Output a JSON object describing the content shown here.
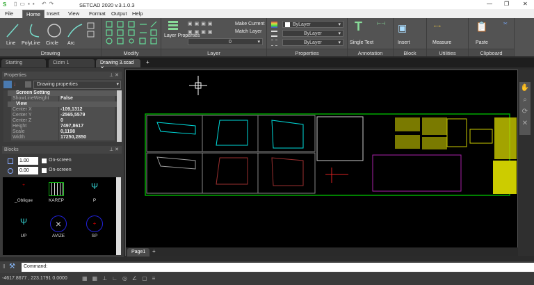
{
  "title": "SETCAD 2020 v.3.1.0.3",
  "menu": [
    "File",
    "Home",
    "Insert",
    "View",
    "Format",
    "Output",
    "Help"
  ],
  "ribbon": {
    "drawing": {
      "label": "Drawing",
      "tools": [
        "Line",
        "PolyLine",
        "Circle",
        "Arc"
      ]
    },
    "modify": {
      "label": "Modify"
    },
    "layer": {
      "label": "Layer",
      "properties": "Layer Properties",
      "make_current": "Make Current",
      "match_layer": "Match Layer",
      "current_layer": "0"
    },
    "properties": {
      "label": "Properties",
      "color": "ByLayer",
      "linetype": "ByLayer",
      "lineweight": "ByLayer"
    },
    "annotation": {
      "label": "Annotation",
      "single_text": "Single Text"
    },
    "block": {
      "label": "Block",
      "insert": "Insert"
    },
    "utilities": {
      "label": "Utilities",
      "measure": "Measure"
    },
    "clipboard": {
      "label": "Clipboard",
      "paste": "Paste"
    }
  },
  "doc_tabs": [
    "Starting",
    "Cizim 1",
    "Drawing 3.scad"
  ],
  "properties_panel": {
    "title": "Properties",
    "selector": "Drawing properties",
    "sections": [
      {
        "name": "Screen Setting",
        "rows": [
          [
            "ShowLineWeight",
            "False"
          ]
        ]
      },
      {
        "name": "View",
        "rows": [
          [
            "Center X",
            "-109,1312"
          ],
          [
            "Center Y",
            "-2565,5579"
          ],
          [
            "Center Z",
            "0"
          ],
          [
            "Height",
            "7497,8617"
          ],
          [
            "Scale",
            "0,1198"
          ],
          [
            "Width",
            "17250,2850"
          ]
        ]
      }
    ]
  },
  "blocks_panel": {
    "title": "Blocks",
    "scale": "1.00",
    "rotation": "0.00",
    "on_screen": "On-screen",
    "items": [
      "_Oblique",
      "KAREP",
      "P",
      "UP",
      "AVIZE",
      "SP"
    ]
  },
  "page_tab": "Page1",
  "command": {
    "label": "Command:"
  },
  "status": {
    "coords": "-4617.8677 , 223.1791  0.0000"
  }
}
